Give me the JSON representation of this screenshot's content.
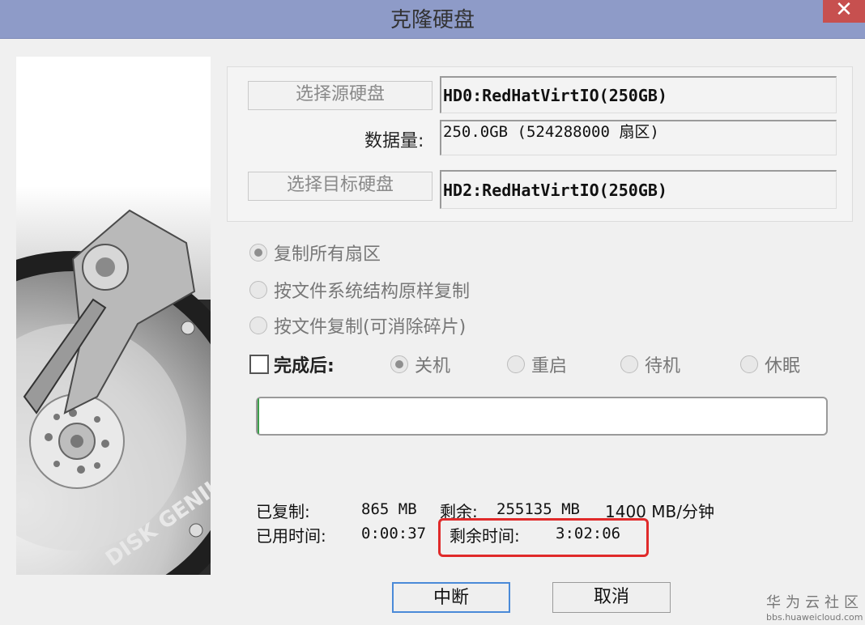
{
  "window": {
    "title": "克隆硬盘",
    "close_glyph": "✕"
  },
  "source": {
    "button_label": "选择源硬盘",
    "value": "HD0:RedHatVirtIO(250GB)"
  },
  "data_size": {
    "label": "数据量:",
    "value": "250.0GB (524288000 扇区)"
  },
  "target": {
    "button_label": "选择目标硬盘",
    "value": "HD2:RedHatVirtIO(250GB)"
  },
  "copy_modes": {
    "selected": 0,
    "options": [
      "复制所有扇区",
      "按文件系统结构原样复制",
      "按文件复制(可消除碎片)"
    ]
  },
  "after_complete": {
    "checkbox_label": "完成后:",
    "checked": false,
    "selected": 0,
    "options": [
      "关机",
      "重启",
      "待机",
      "休眠"
    ]
  },
  "progress": {
    "fraction": 0.0034
  },
  "stats": {
    "copied_label": "已复制:",
    "copied_value": "865 MB",
    "remaining_label": "剩余:",
    "remaining_value": "255135 MB",
    "speed": "1400 MB/分钟",
    "elapsed_label": "已用时间:",
    "elapsed_value": "0:00:37",
    "time_left_label": "剩余时间:",
    "time_left_value": "3:02:06"
  },
  "buttons": {
    "interrupt": "中断",
    "cancel": "取消"
  },
  "branding": {
    "disk_logo_text": "DISK GENIUS"
  },
  "watermark": {
    "name": "华为云社区",
    "url": "bbs.huaweicloud.com"
  },
  "colors": {
    "titlebar": "#8e9bc8",
    "close_button": "#c7504f",
    "highlight_box": "#e02a2a",
    "progress_fill": "#3b9e4a"
  }
}
